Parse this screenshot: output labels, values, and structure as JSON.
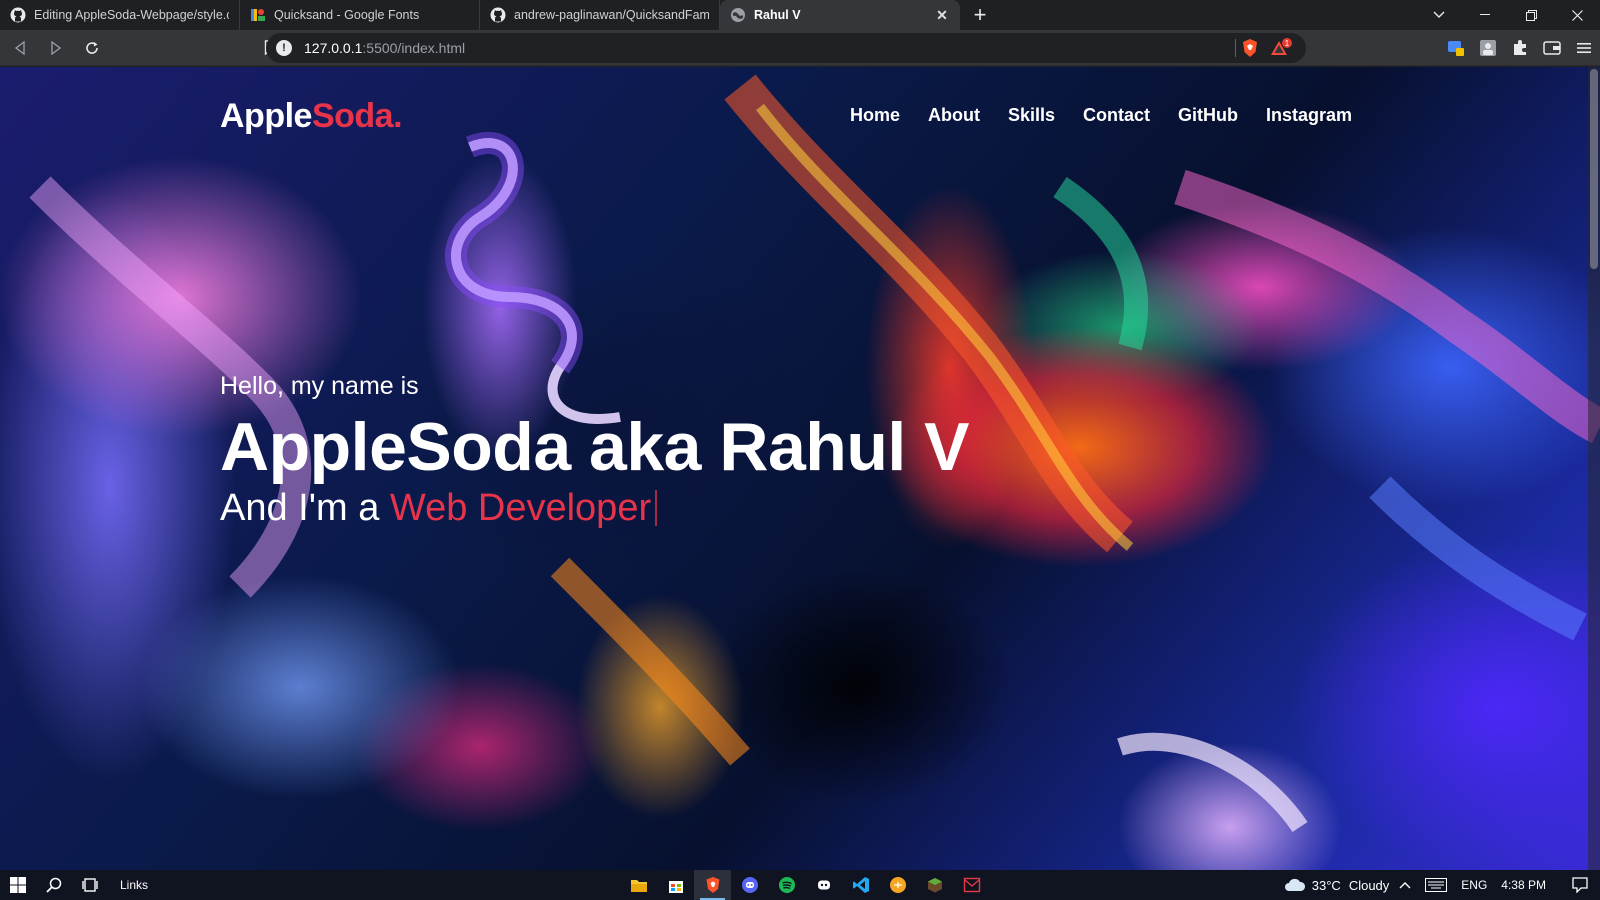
{
  "browser": {
    "tabs": [
      {
        "title": "Editing AppleSoda-Webpage/style.css",
        "icon": "github-icon",
        "active": false
      },
      {
        "title": "Quicksand - Google Fonts",
        "icon": "google-fonts-icon",
        "active": false
      },
      {
        "title": "andrew-paglinawan/QuicksandFamily",
        "icon": "github-icon",
        "active": false
      },
      {
        "title": "Rahul V",
        "icon": "globe-icon",
        "active": true
      }
    ],
    "close_tab_symbol": "✕",
    "new_tab_symbol": "+",
    "address": {
      "host": "127.0.0.1",
      "path": ":5500/index.html"
    },
    "rewards_badge": "1"
  },
  "site": {
    "logo": {
      "main": "Apple",
      "accent": "Soda."
    },
    "nav": [
      "Home",
      "About",
      "Skills",
      "Contact",
      "GitHub",
      "Instagram"
    ],
    "hero": {
      "greeting": "Hello, my name is",
      "name": "AppleSoda aka Rahul V",
      "role_prefix": "And I'm a ",
      "role_accent": "Web Developer"
    },
    "accent_color": "#e8344b"
  },
  "taskbar": {
    "links_label": "Links",
    "weather": {
      "temp": "33°C",
      "condition": "Cloudy"
    },
    "language": "ENG",
    "time": "4:38 PM",
    "apps": [
      "file-explorer-icon",
      "store-icon",
      "brave-icon",
      "discord-icon",
      "spotify-icon",
      "discord-icon",
      "vscode-icon",
      "app-icon",
      "minecraft-icon",
      "mail-icon"
    ]
  }
}
